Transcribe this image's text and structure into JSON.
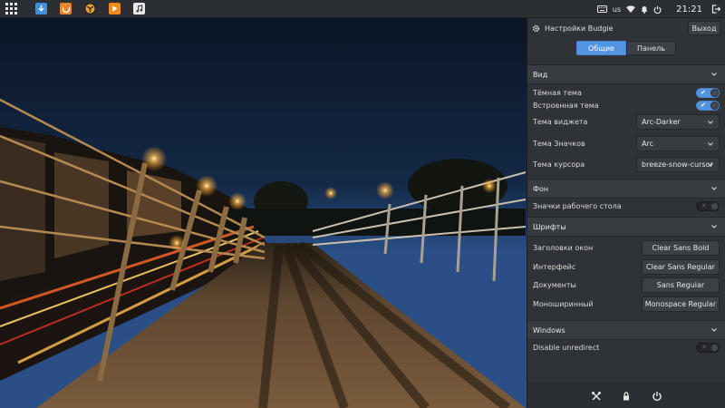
{
  "top_panel": {
    "keyboard_layout": "us",
    "clock": "21:21",
    "launchers": [
      {
        "name": "download-manager",
        "color": "#3d8fe0"
      },
      {
        "name": "firefox",
        "color": "#e8822b"
      },
      {
        "name": "media-player",
        "color": "#2a2a2a"
      },
      {
        "name": "video-player",
        "color": "#f08a1c"
      },
      {
        "name": "music-player",
        "color": "#e8e8e8"
      }
    ]
  },
  "raven": {
    "title": "Настройки Budgie",
    "exit_label": "Выход",
    "tabs": [
      "Общие",
      "Панель"
    ],
    "active_tab": 0,
    "sections": {
      "view": {
        "title": "Вид",
        "dark_theme": {
          "label": "Тёмная тема",
          "on": true
        },
        "builtin_theme": {
          "label": "Встроенная тема",
          "on": true
        },
        "widget_theme": {
          "label": "Тема виджета",
          "value": "Arc-Darker"
        },
        "icon_theme": {
          "label": "Тема Значков",
          "value": "Arc"
        },
        "cursor_theme": {
          "label": "Тема курсора",
          "value": "breeze-snow-cursor"
        }
      },
      "background": {
        "title": "Фон",
        "desktop_icons": {
          "label": "Значки рабочего стола",
          "on": false
        }
      },
      "fonts": {
        "title": "Шрифты",
        "window_titles": {
          "label": "Заголовки окон",
          "value": "Clear Sans Bold"
        },
        "interface": {
          "label": "Интерфейс",
          "value": "Clear Sans Regular"
        },
        "documents": {
          "label": "Документы",
          "value": "Sans Regular"
        },
        "monospace": {
          "label": "Моноширинный",
          "value": "Monospace Regular"
        }
      },
      "windows": {
        "title": "Windows",
        "disable_unredirect": {
          "label": "Disable unredirect",
          "on": false
        }
      }
    },
    "accent_color": "#5294e2"
  }
}
